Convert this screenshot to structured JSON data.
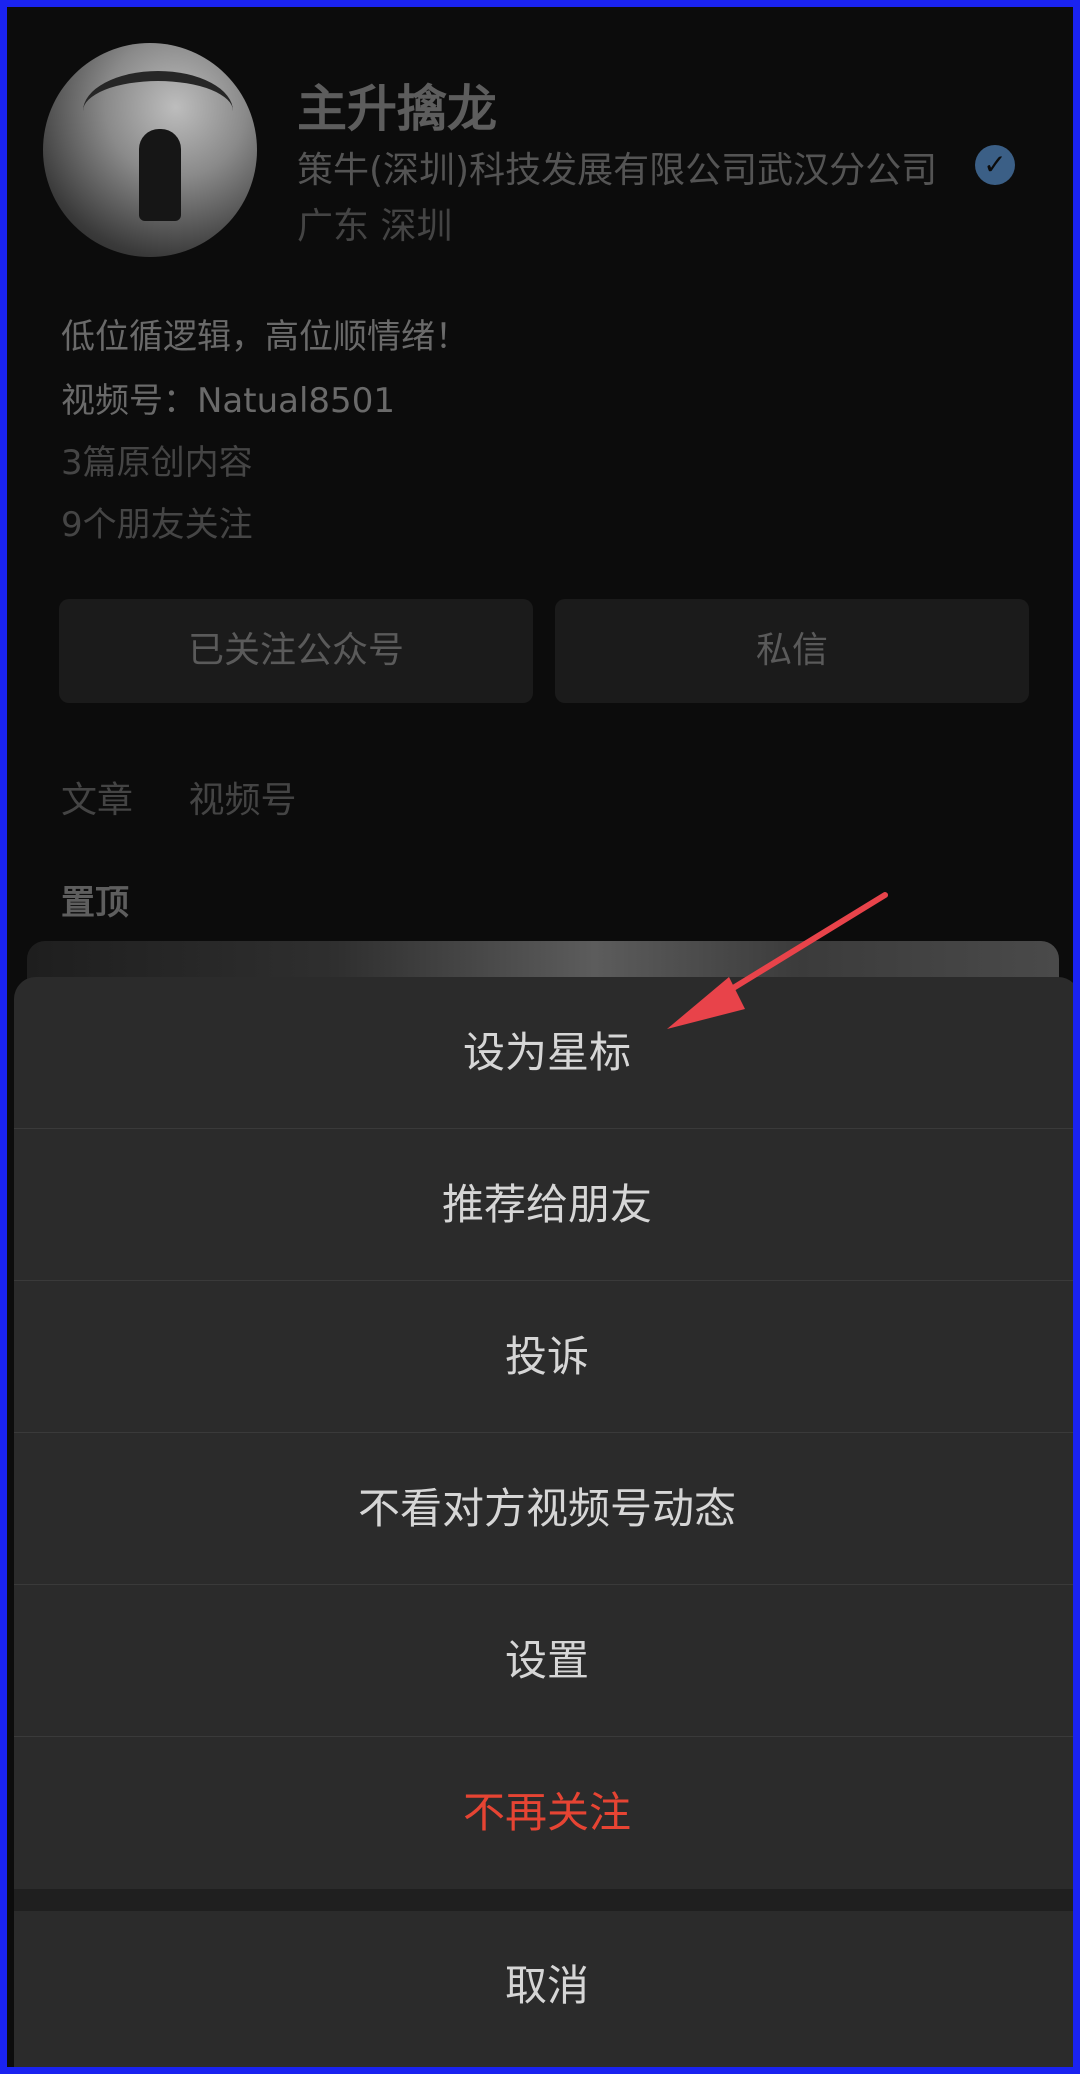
{
  "profile": {
    "name": "主升擒龙",
    "company": "策牛(深圳)科技发展有限公司武汉分公司",
    "location": "广东 深圳",
    "signature": "低位循逻辑，高位顺情绪！",
    "channel": "视频号：Natual8501",
    "articles": "3篇原创内容",
    "friends_following": "9个朋友关注",
    "follow_button": "已关注公众号",
    "message_button": "私信",
    "tabs": [
      "文章",
      "视频号"
    ],
    "pinned_label": "置顶",
    "verified_icon": "verified-badge-icon"
  },
  "menu": {
    "items": [
      {
        "label": "设为星标"
      },
      {
        "label": "推荐给朋友"
      },
      {
        "label": "投诉"
      },
      {
        "label": "不看对方视频号动态"
      },
      {
        "label": "设置"
      },
      {
        "label": "不再关注"
      }
    ],
    "cancel": "取消"
  },
  "colors": {
    "accent_danger": "#e64433",
    "frame_border": "#1a23f0",
    "annotation_arrow": "#e8434a"
  }
}
